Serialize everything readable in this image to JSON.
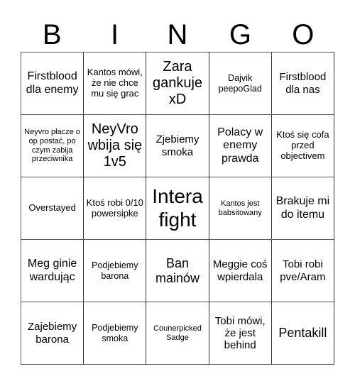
{
  "header": {
    "letters": [
      "B",
      "I",
      "N",
      "G",
      "O"
    ]
  },
  "cells": [
    "Firstblood dla enemy",
    "Kantos mówi, że nie chce mu się grac",
    "Zara gankuje xD",
    "Dajvik peepoGlad",
    "Firstblood dla nas",
    "Neyvro płacze o op postać, po czym zabija przeciwnika",
    "NeyVro wbija się 1v5",
    "Zjebiemy smoka",
    "Polacy w enemy prawda",
    "Ktoś się cofa przed objectivem",
    "Overstayed",
    "Ktoś robi 0/10 powersipke",
    "Intera fight",
    "Kantos jest babsitowany",
    "Brakuje mi do itemu",
    "Meg ginie wardując",
    "Podjebiemy barona",
    "Ban mainów",
    "Meggie coś wpierdala",
    "Tobi robi pve/Aram",
    "Zajebiemy barona",
    "Podjebiemy smoka",
    "Counerpicked Sadge",
    "Tobi mówi, że jest behind",
    "Pentakill"
  ]
}
